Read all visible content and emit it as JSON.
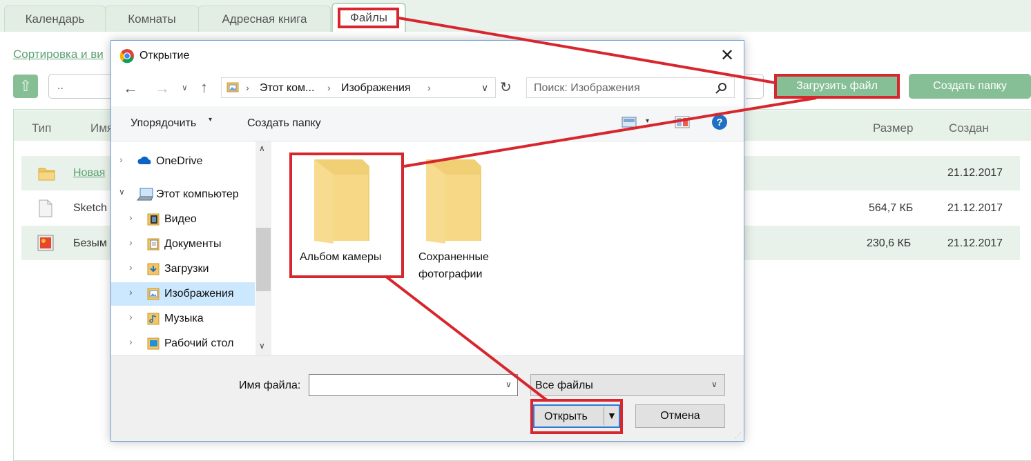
{
  "app_tabs": [
    "Календарь",
    "Комнаты",
    "Адресная книга",
    "Файлы"
  ],
  "sort_link": "Сортировка и ви",
  "path_value": "..",
  "buttons": {
    "upload": "Загрузить файл",
    "create_folder": "Создать папку"
  },
  "table": {
    "headers": {
      "type": "Тип",
      "name": "Имя",
      "size": "Размер",
      "created": "Создан"
    },
    "rows": [
      {
        "name": "Новая",
        "size": "",
        "created": "21.12.2017",
        "icon": "folder-icon"
      },
      {
        "name": "Sketch",
        "size": "564,7 КБ",
        "created": "21.12.2017",
        "icon": "document-icon"
      },
      {
        "name": "Безым",
        "size": "230,6 КБ",
        "created": "21.12.2017",
        "icon": "image-icon"
      }
    ]
  },
  "dialog": {
    "title": "Открытие",
    "breadcrumb": [
      "Этот ком...",
      "Изображения"
    ],
    "search_placeholder": "Поиск: Изображения",
    "toolbar": {
      "organize": "Упорядочить",
      "new_folder": "Создать папку"
    },
    "nav_items": [
      {
        "label": "OneDrive",
        "icon": "onedrive-icon"
      },
      {
        "label": "Этот компьютер",
        "icon": "computer-icon"
      },
      {
        "label": "Видео",
        "icon": "video-folder-icon"
      },
      {
        "label": "Документы",
        "icon": "documents-folder-icon"
      },
      {
        "label": "Загрузки",
        "icon": "downloads-folder-icon"
      },
      {
        "label": "Изображения",
        "icon": "pictures-folder-icon"
      },
      {
        "label": "Музыка",
        "icon": "music-folder-icon"
      },
      {
        "label": "Рабочий стол",
        "icon": "desktop-folder-icon"
      }
    ],
    "folders": [
      {
        "label": "Альбом камеры"
      },
      {
        "label": "Сохраненные фотографии"
      }
    ],
    "filename_label": "Имя файла:",
    "filename_value": "",
    "filter_value": "Все файлы",
    "open_label": "Открыть",
    "cancel_label": "Отмена"
  },
  "colors": {
    "accent_green": "#86bf96",
    "annotation_red": "#d7262e",
    "dialog_border": "#6fa0d8"
  }
}
